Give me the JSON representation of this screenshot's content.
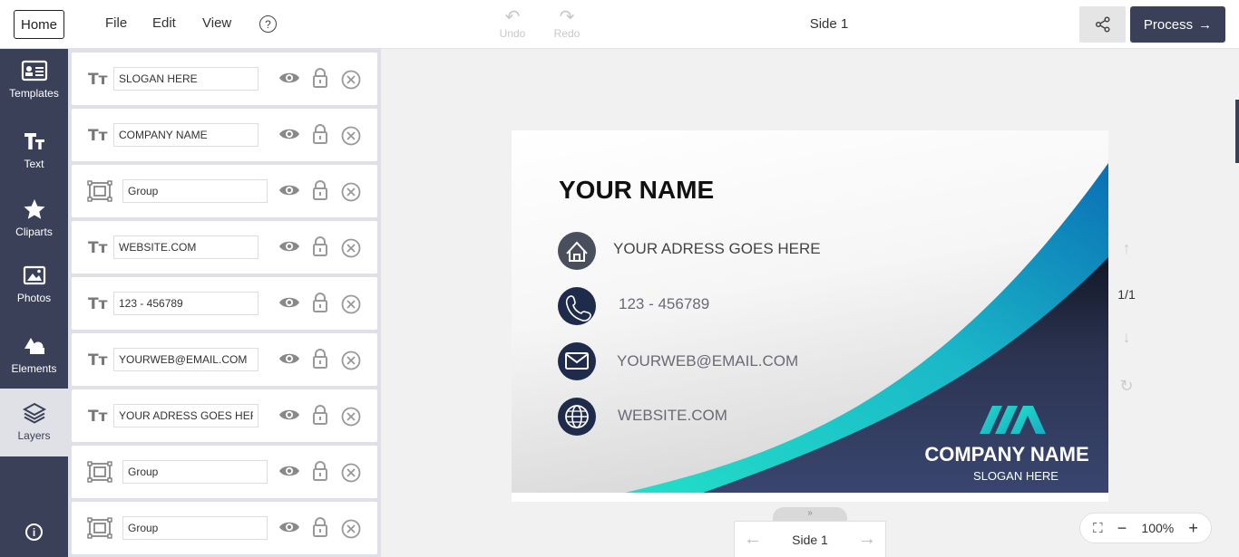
{
  "toolbar": {
    "home": "Home",
    "menu": [
      "File",
      "Edit",
      "View"
    ],
    "help": "?",
    "undo": "Undo",
    "redo": "Redo",
    "title": "Side 1",
    "process": "Process"
  },
  "nav": {
    "templates": "Templates",
    "text": "Text",
    "cliparts": "Cliparts",
    "photos": "Photos",
    "elements": "Elements",
    "layers": "Layers",
    "info": "i"
  },
  "layers": [
    {
      "type": "text",
      "value": "SLOGAN HERE"
    },
    {
      "type": "text",
      "value": "COMPANY NAME"
    },
    {
      "type": "group",
      "value": "Group"
    },
    {
      "type": "text",
      "value": "WEBSITE.COM"
    },
    {
      "type": "text",
      "value": "123 - 456789"
    },
    {
      "type": "text",
      "value": "YOURWEB@EMAIL.COM"
    },
    {
      "type": "text",
      "value": "YOUR ADRESS GOES HERE"
    },
    {
      "type": "group",
      "value": "Group"
    },
    {
      "type": "group",
      "value": "Group"
    }
  ],
  "card": {
    "name": "YOUR NAME",
    "address": "YOUR ADRESS GOES HERE",
    "phone": "123 - 456789",
    "email": "YOURWEB@EMAIL.COM",
    "website": "WEBSITE.COM",
    "company": "COMPANY NAME",
    "slogan": "SLOGAN HERE",
    "colors": {
      "navy": "#3b4059",
      "teal": "#22d3c5",
      "blue": "#0a7bbf",
      "icon_gray": "#4a4f5e",
      "icon_navy": "#1f2b4a"
    }
  },
  "pager": {
    "count": "1/1"
  },
  "bottom": {
    "side": "Side 1",
    "tab": "»"
  },
  "zoom": {
    "value": "100%"
  }
}
